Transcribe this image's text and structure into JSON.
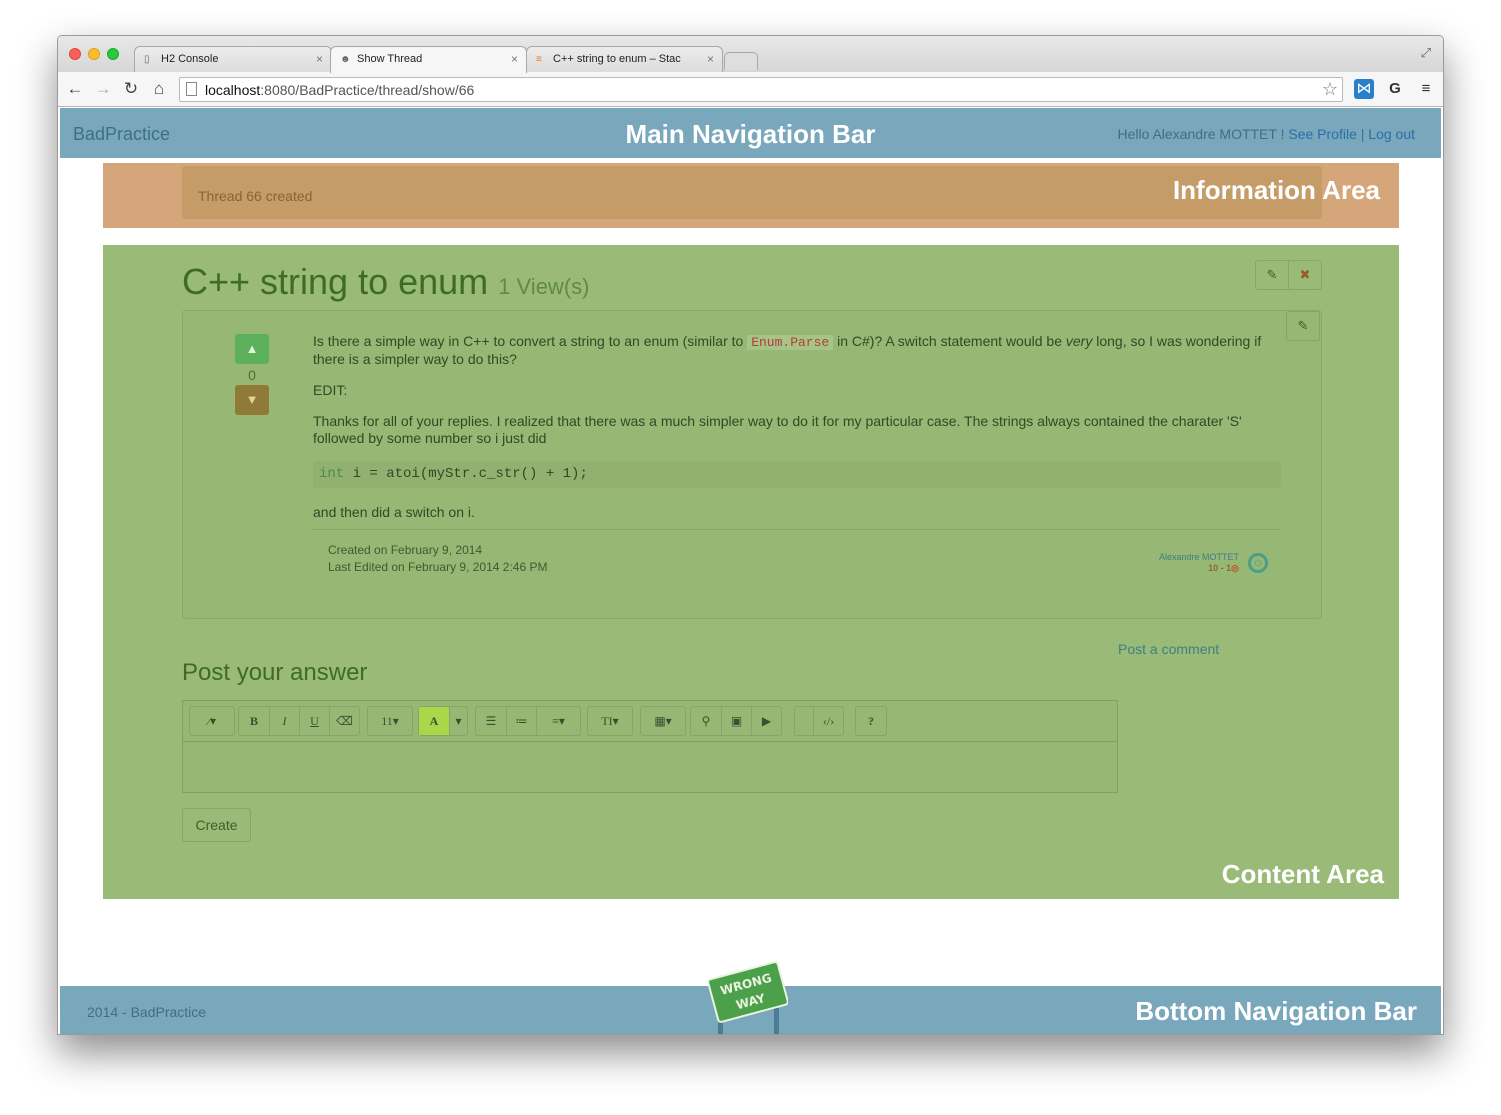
{
  "browser": {
    "tabs": [
      {
        "title": "H2 Console",
        "close": "×"
      },
      {
        "title": "Show Thread",
        "close": "×"
      },
      {
        "title": "C++ string to enum – Stac",
        "close": "×"
      }
    ],
    "url_host": "localhost",
    "url_path": ":8080/BadPractice/thread/show/66"
  },
  "mainnav": {
    "brand": "BadPractice",
    "label": "Main Navigation Bar",
    "hello": "Hello Alexandre MOTTET ! ",
    "see_profile": "See Profile",
    "sep": " | ",
    "logout": "Log out"
  },
  "info": {
    "message": "Thread 66 created",
    "label": "Information Area"
  },
  "content": {
    "label": "Content Area",
    "title": "C++ string to enum",
    "views": "1 View(s)",
    "vote_count": "0",
    "body": {
      "p1_before": "Is there a simple way in C++ to convert a string to an enum (similar to ",
      "p1_code": "Enum.Parse",
      "p1_mid": " in C#)? A switch statement would be ",
      "p1_em": "very",
      "p1_after": " long, so I was wondering if there is a simpler way to do this?",
      "p2": "EDIT:",
      "p3": "Thanks for all of your replies. I realized that there was a much simpler way to do it for my particular case. The strings always contained the charater 'S' followed by some number so i just did",
      "code_kw": "int",
      "code_rest": " i = atoi(myStr.c_str() + 1);",
      "p4": "and then did a switch on i."
    },
    "created": "Created on February 9, 2014",
    "edited": "Last Edited on February 9, 2014 2:46 PM",
    "author": "Alexandre MOTTET",
    "author_rep": "10 - 1",
    "post_comment": "Post a comment",
    "answer_heading": "Post your answer",
    "editor_buttons": {
      "font_size": "11",
      "bold": "B",
      "italic": "I",
      "underline": "U",
      "help": "?",
      "textsize": "TI"
    },
    "create_button": "Create"
  },
  "bottomnav": {
    "copyright": "2014 - BadPractice",
    "label": "Bottom Navigation Bar"
  },
  "sign": {
    "line1": "WRONG",
    "line2": "WAY"
  },
  "colors": {
    "nav": "#79a7bb",
    "info": "#d6a67b",
    "content": "#9aba78"
  },
  "icons": [
    "back-icon",
    "forward-icon",
    "reload-icon",
    "home-icon",
    "star-icon",
    "pencil-icon",
    "close-icon",
    "chevron-up-icon",
    "chevron-down-icon",
    "power-icon"
  ]
}
